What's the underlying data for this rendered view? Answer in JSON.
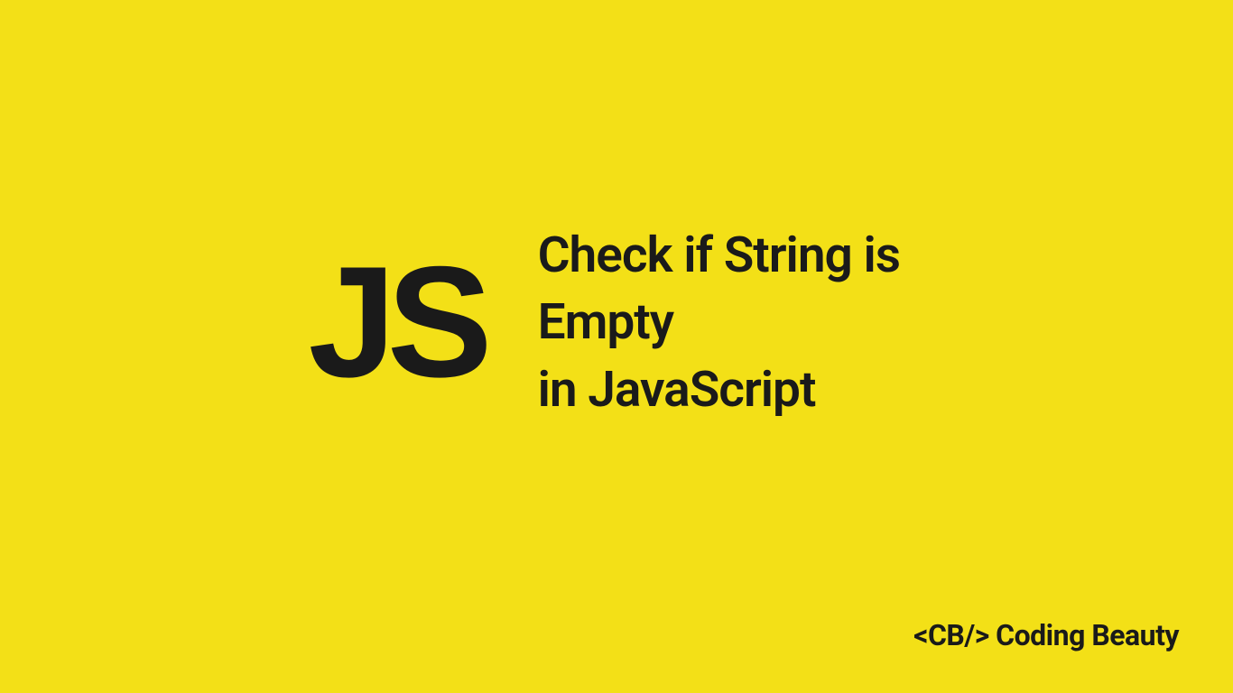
{
  "logo": {
    "text": "JS"
  },
  "title": {
    "line1": "Check if String is Empty",
    "line2": "in JavaScript"
  },
  "brand": {
    "prefix": "<CB/>",
    "name": "Coding Beauty"
  },
  "colors": {
    "background": "#f3e017",
    "text": "#1a1a1a"
  }
}
